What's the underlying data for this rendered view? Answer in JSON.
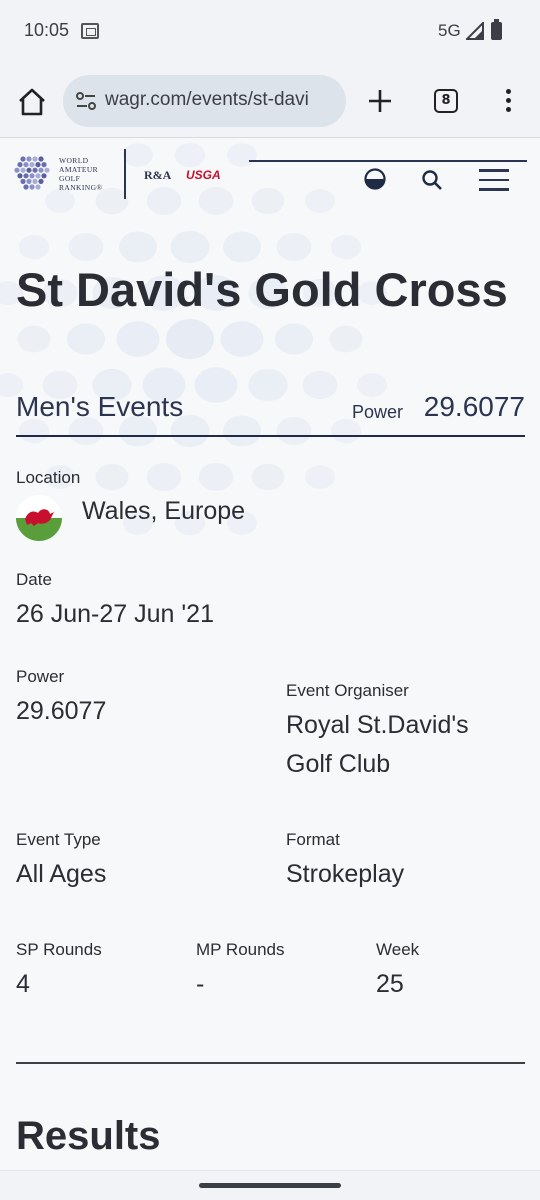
{
  "status_bar": {
    "time": "10:05",
    "network": "5G"
  },
  "browser": {
    "url": "wagr.com/events/st-davi",
    "tab_count": "8"
  },
  "header": {
    "logo_lines": [
      "WORLD",
      "AMATEUR",
      "GOLF",
      "RANKING®"
    ],
    "partner_1": "R&A",
    "partner_2": "USGA"
  },
  "event": {
    "title": "St David's Gold Cross",
    "category": "Men's Events",
    "power_label": "Power",
    "power_value": "29.6077"
  },
  "details": {
    "location_label": "Location",
    "location_value": "Wales, Europe",
    "date_label": "Date",
    "date_value": "26 Jun-27 Jun '21",
    "power_label": "Power",
    "power_value": "29.6077",
    "organiser_label": "Event Organiser",
    "organiser_value": "Royal St.David's Golf Club",
    "type_label": "Event Type",
    "type_value": "All Ages",
    "format_label": "Format",
    "format_value": "Strokeplay",
    "sp_rounds_label": "SP Rounds",
    "sp_rounds_value": "4",
    "mp_rounds_label": "MP Rounds",
    "mp_rounds_value": "-",
    "week_label": "Week",
    "week_value": "25"
  },
  "results_heading": "Results",
  "colors": {
    "navy": "#1f2a44",
    "usga_red": "#c8102e",
    "wales_green": "#5a9e3c",
    "wales_red": "#c8102e"
  },
  "icons": [
    "home-icon",
    "site-settings-icon",
    "plus-icon",
    "tabs-icon",
    "more-icon",
    "theme-toggle-icon",
    "search-icon",
    "hamburger-icon",
    "wales-flag-icon"
  ]
}
